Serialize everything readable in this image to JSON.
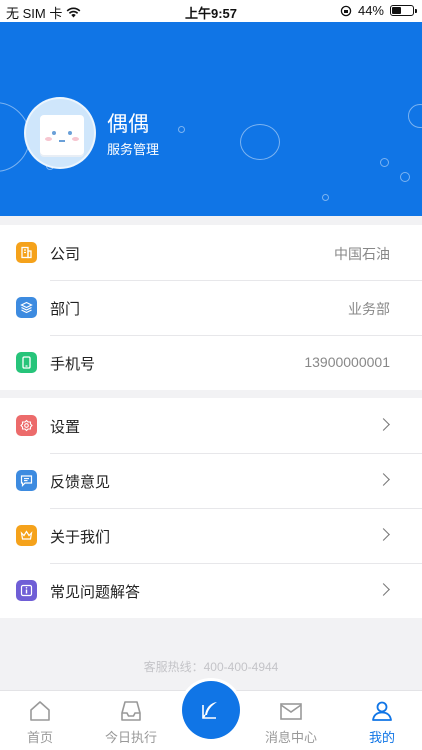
{
  "status_bar": {
    "carrier": "无 SIM 卡",
    "time": "上午9:57",
    "battery_text": "44%",
    "battery_level": 0.44
  },
  "profile": {
    "name": "偶偶",
    "role": "服务管理"
  },
  "info_rows": [
    {
      "label": "公司",
      "value": "中国石油",
      "icon": "building-icon",
      "color": "#f5a21b"
    },
    {
      "label": "部门",
      "value": "业务部",
      "icon": "layers-icon",
      "color": "#3d8be0"
    },
    {
      "label": "手机号",
      "value": "13900000001",
      "icon": "phone-icon",
      "color": "#27c47a"
    }
  ],
  "menu_rows": [
    {
      "label": "设置",
      "icon": "gear-icon",
      "color": "#ec6b6b"
    },
    {
      "label": "反馈意见",
      "icon": "chat-icon",
      "color": "#3d8be0"
    },
    {
      "label": "关于我们",
      "icon": "crown-icon",
      "color": "#f5a21b"
    },
    {
      "label": "常见问题解答",
      "icon": "info-icon",
      "color": "#6f5ed6"
    }
  ],
  "hotline": "客服热线：400-400-4944",
  "tabs": [
    {
      "label": "首页",
      "icon": "home-icon",
      "active": false
    },
    {
      "label": "今日执行",
      "icon": "inbox-icon",
      "active": false
    },
    {
      "label": "消息中心",
      "icon": "mail-icon",
      "active": false
    },
    {
      "label": "我的",
      "icon": "user-icon",
      "active": true
    }
  ],
  "colors": {
    "brand": "#1075e6",
    "background": "#f2f2f4"
  }
}
